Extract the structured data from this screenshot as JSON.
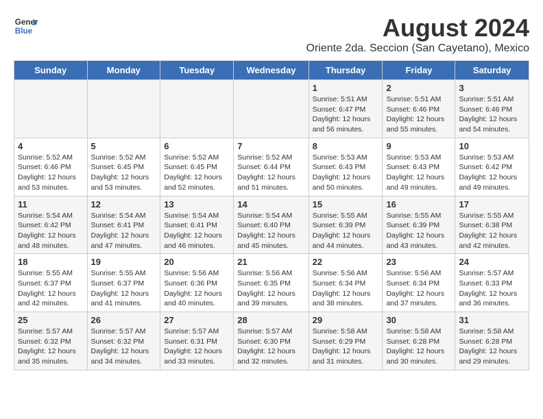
{
  "logo": {
    "line1": "General",
    "line2": "Blue"
  },
  "title": "August 2024",
  "subtitle": "Oriente 2da. Seccion (San Cayetano), Mexico",
  "days_of_week": [
    "Sunday",
    "Monday",
    "Tuesday",
    "Wednesday",
    "Thursday",
    "Friday",
    "Saturday"
  ],
  "weeks": [
    [
      {
        "day": "",
        "info": ""
      },
      {
        "day": "",
        "info": ""
      },
      {
        "day": "",
        "info": ""
      },
      {
        "day": "",
        "info": ""
      },
      {
        "day": "1",
        "info": "Sunrise: 5:51 AM\nSunset: 6:47 PM\nDaylight: 12 hours\nand 56 minutes."
      },
      {
        "day": "2",
        "info": "Sunrise: 5:51 AM\nSunset: 6:46 PM\nDaylight: 12 hours\nand 55 minutes."
      },
      {
        "day": "3",
        "info": "Sunrise: 5:51 AM\nSunset: 6:46 PM\nDaylight: 12 hours\nand 54 minutes."
      }
    ],
    [
      {
        "day": "4",
        "info": "Sunrise: 5:52 AM\nSunset: 6:46 PM\nDaylight: 12 hours\nand 53 minutes."
      },
      {
        "day": "5",
        "info": "Sunrise: 5:52 AM\nSunset: 6:45 PM\nDaylight: 12 hours\nand 53 minutes."
      },
      {
        "day": "6",
        "info": "Sunrise: 5:52 AM\nSunset: 6:45 PM\nDaylight: 12 hours\nand 52 minutes."
      },
      {
        "day": "7",
        "info": "Sunrise: 5:52 AM\nSunset: 6:44 PM\nDaylight: 12 hours\nand 51 minutes."
      },
      {
        "day": "8",
        "info": "Sunrise: 5:53 AM\nSunset: 6:43 PM\nDaylight: 12 hours\nand 50 minutes."
      },
      {
        "day": "9",
        "info": "Sunrise: 5:53 AM\nSunset: 6:43 PM\nDaylight: 12 hours\nand 49 minutes."
      },
      {
        "day": "10",
        "info": "Sunrise: 5:53 AM\nSunset: 6:42 PM\nDaylight: 12 hours\nand 49 minutes."
      }
    ],
    [
      {
        "day": "11",
        "info": "Sunrise: 5:54 AM\nSunset: 6:42 PM\nDaylight: 12 hours\nand 48 minutes."
      },
      {
        "day": "12",
        "info": "Sunrise: 5:54 AM\nSunset: 6:41 PM\nDaylight: 12 hours\nand 47 minutes."
      },
      {
        "day": "13",
        "info": "Sunrise: 5:54 AM\nSunset: 6:41 PM\nDaylight: 12 hours\nand 46 minutes."
      },
      {
        "day": "14",
        "info": "Sunrise: 5:54 AM\nSunset: 6:40 PM\nDaylight: 12 hours\nand 45 minutes."
      },
      {
        "day": "15",
        "info": "Sunrise: 5:55 AM\nSunset: 6:39 PM\nDaylight: 12 hours\nand 44 minutes."
      },
      {
        "day": "16",
        "info": "Sunrise: 5:55 AM\nSunset: 6:39 PM\nDaylight: 12 hours\nand 43 minutes."
      },
      {
        "day": "17",
        "info": "Sunrise: 5:55 AM\nSunset: 6:38 PM\nDaylight: 12 hours\nand 42 minutes."
      }
    ],
    [
      {
        "day": "18",
        "info": "Sunrise: 5:55 AM\nSunset: 6:37 PM\nDaylight: 12 hours\nand 42 minutes."
      },
      {
        "day": "19",
        "info": "Sunrise: 5:55 AM\nSunset: 6:37 PM\nDaylight: 12 hours\nand 41 minutes."
      },
      {
        "day": "20",
        "info": "Sunrise: 5:56 AM\nSunset: 6:36 PM\nDaylight: 12 hours\nand 40 minutes."
      },
      {
        "day": "21",
        "info": "Sunrise: 5:56 AM\nSunset: 6:35 PM\nDaylight: 12 hours\nand 39 minutes."
      },
      {
        "day": "22",
        "info": "Sunrise: 5:56 AM\nSunset: 6:34 PM\nDaylight: 12 hours\nand 38 minutes."
      },
      {
        "day": "23",
        "info": "Sunrise: 5:56 AM\nSunset: 6:34 PM\nDaylight: 12 hours\nand 37 minutes."
      },
      {
        "day": "24",
        "info": "Sunrise: 5:57 AM\nSunset: 6:33 PM\nDaylight: 12 hours\nand 36 minutes."
      }
    ],
    [
      {
        "day": "25",
        "info": "Sunrise: 5:57 AM\nSunset: 6:32 PM\nDaylight: 12 hours\nand 35 minutes."
      },
      {
        "day": "26",
        "info": "Sunrise: 5:57 AM\nSunset: 6:32 PM\nDaylight: 12 hours\nand 34 minutes."
      },
      {
        "day": "27",
        "info": "Sunrise: 5:57 AM\nSunset: 6:31 PM\nDaylight: 12 hours\nand 33 minutes."
      },
      {
        "day": "28",
        "info": "Sunrise: 5:57 AM\nSunset: 6:30 PM\nDaylight: 12 hours\nand 32 minutes."
      },
      {
        "day": "29",
        "info": "Sunrise: 5:58 AM\nSunset: 6:29 PM\nDaylight: 12 hours\nand 31 minutes."
      },
      {
        "day": "30",
        "info": "Sunrise: 5:58 AM\nSunset: 6:28 PM\nDaylight: 12 hours\nand 30 minutes."
      },
      {
        "day": "31",
        "info": "Sunrise: 5:58 AM\nSunset: 6:28 PM\nDaylight: 12 hours\nand 29 minutes."
      }
    ]
  ]
}
